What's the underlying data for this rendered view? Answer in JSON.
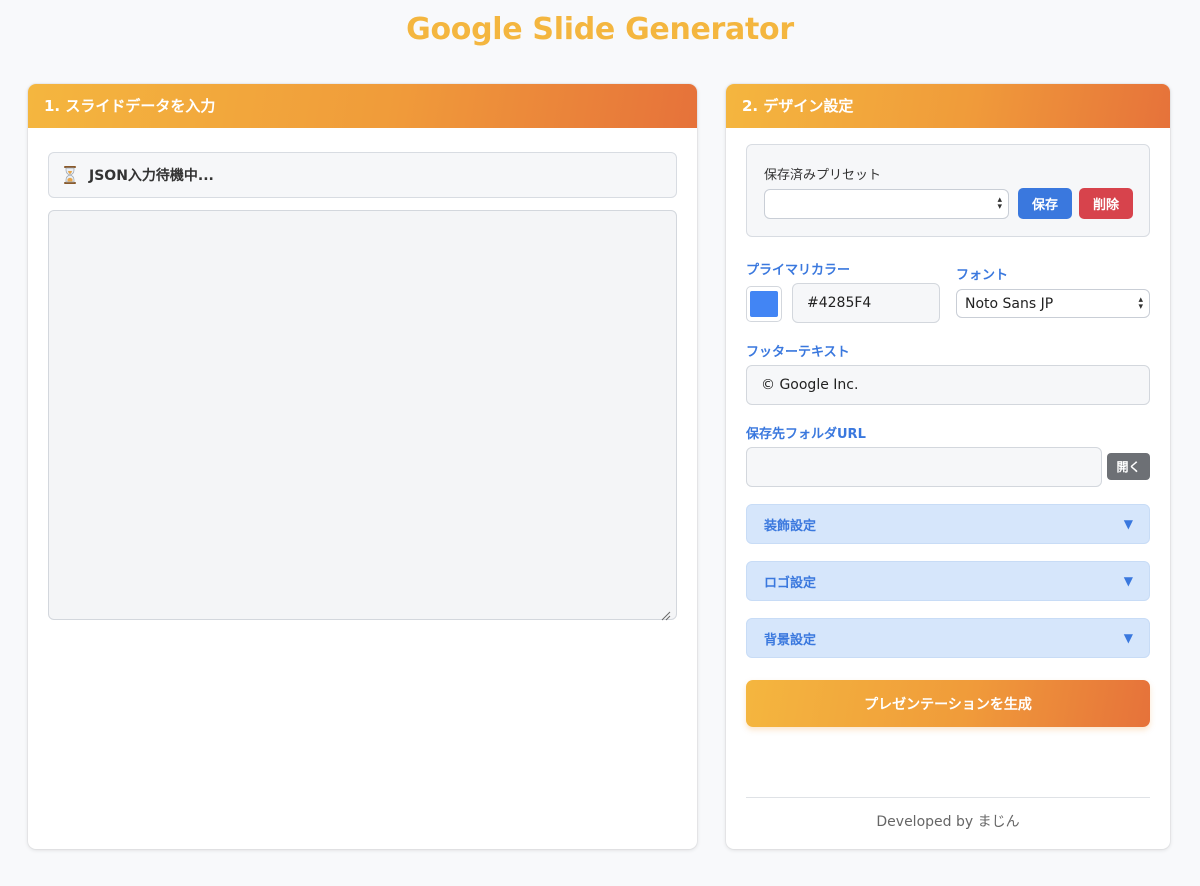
{
  "app": {
    "title": "Google Slide Generator",
    "title_color": "#f4b63f"
  },
  "input_panel": {
    "header": "1. スライドデータを入力",
    "status": {
      "icon": "hourglass-icon",
      "text": "JSON入力待機中..."
    },
    "json_value": ""
  },
  "design_panel": {
    "header": "2. デザイン設定",
    "presets": {
      "label": "保存済みプリセット",
      "selected": "",
      "save_label": "保存",
      "delete_label": "削除"
    },
    "primary_color": {
      "label": "プライマリカラー",
      "value": "#4285F4",
      "swatch": "#4285f4"
    },
    "font": {
      "label": "フォント",
      "selected": "Noto Sans JP"
    },
    "footer_text": {
      "label": "フッターテキスト",
      "value": "© Google Inc."
    },
    "folder_url": {
      "label": "保存先フォルダURL",
      "value": "",
      "open_label": "開く"
    },
    "accordions": [
      {
        "label": "装飾設定",
        "icon": "triangle-down-icon"
      },
      {
        "label": "ロゴ設定",
        "icon": "triangle-down-icon"
      },
      {
        "label": "背景設定",
        "icon": "triangle-down-icon"
      }
    ],
    "generate_label": "プレゼンテーションを生成",
    "credit": "Developed by まじん"
  },
  "colors": {
    "accent_start": "#f4b63f",
    "accent_end": "#e6723a",
    "link_blue": "#3a78de",
    "danger": "#d7434c"
  }
}
